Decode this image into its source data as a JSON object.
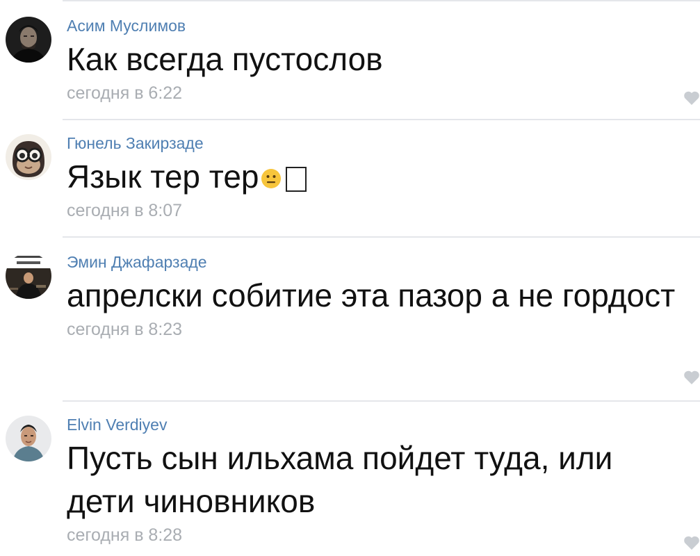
{
  "comments": [
    {
      "author": "Асим Муслимов",
      "text": "Как всегда пустослов",
      "time": "сегодня в 6:22"
    },
    {
      "author": "Гюнель Закирзаде",
      "text": "Язык тер тер",
      "time": "сегодня в 8:07"
    },
    {
      "author": "Эмин Джафарзаде",
      "text": "апрелски собитие эта пазор а не гордост",
      "time": "сегодня в 8:23"
    },
    {
      "author": "Elvin Verdiyev",
      "text": "Пусть сын ильхама пойдет туда, или дети чиновников",
      "time": "сегодня в 8:28"
    }
  ],
  "colors": {
    "author": "#4f7fb2",
    "text": "#111111",
    "time": "#a9adb2",
    "like_icon": "#c9cdd2",
    "divider": "#e4e6ea"
  },
  "icons": {
    "like": "heart-icon",
    "emoji": "neutral-face-emoji-icon",
    "missing_glyph": "unsupported-character-box"
  }
}
